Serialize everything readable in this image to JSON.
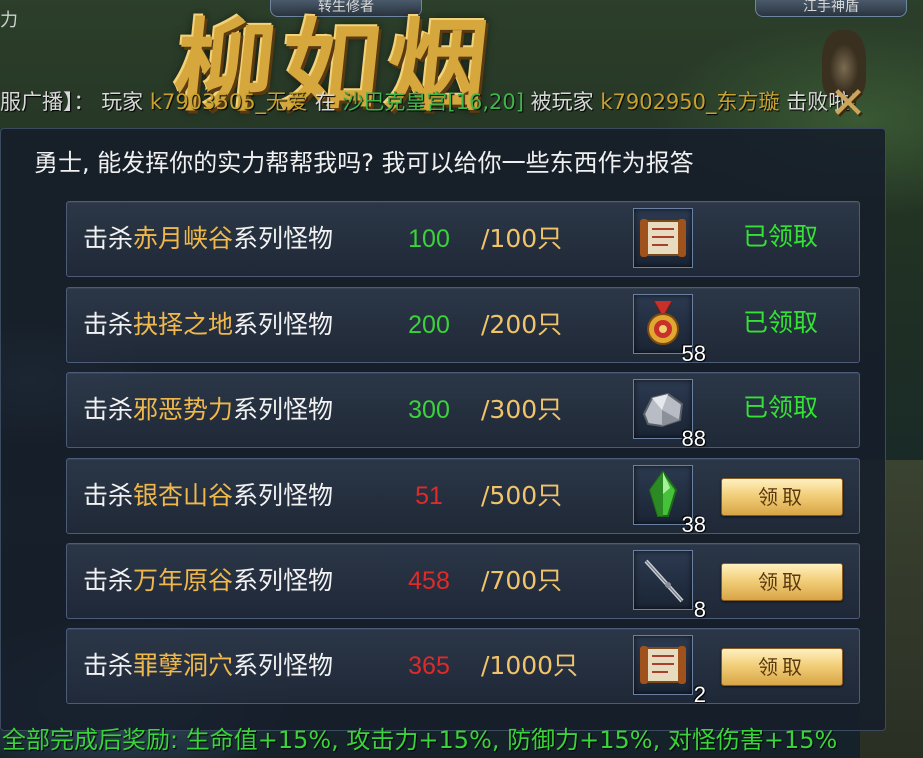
{
  "header": {
    "left_tab": "转生修者",
    "right_tab": "江手神盾",
    "edge_text": "力",
    "title": "柳如烟",
    "close_icon": "close-icon"
  },
  "broadcast": {
    "prefix": "服广播】：",
    "t1": "玩家",
    "player1": "k7903505_无爱",
    "t2": "在",
    "place": "沙巴克皇宫[16,20]",
    "t3": "被玩家",
    "player2": "k7902950_东方璇",
    "t4": "击败啦!"
  },
  "intro": "勇士, 能发挥你的实力帮帮我吗? 我可以给你一些东西作为报答",
  "quests": [
    {
      "prefix": "击杀",
      "area": "赤月峡谷",
      "suffix": "系列怪物",
      "current": "100",
      "target": "/100只",
      "status": "done",
      "reward_icon": "scroll-icon",
      "reward_qty": "",
      "action": "已领取"
    },
    {
      "prefix": "击杀",
      "area": "抉择之地",
      "suffix": "系列怪物",
      "current": "200",
      "target": "/200只",
      "status": "done",
      "reward_icon": "medal-icon",
      "reward_qty": "58",
      "action": "已领取"
    },
    {
      "prefix": "击杀",
      "area": "邪恶势力",
      "suffix": "系列怪物",
      "current": "300",
      "target": "/300只",
      "status": "done",
      "reward_icon": "ore-icon",
      "reward_qty": "88",
      "action": "已领取"
    },
    {
      "prefix": "击杀",
      "area": "银杏山谷",
      "suffix": "系列怪物",
      "current": "51",
      "target": "/500只",
      "status": "todo",
      "reward_icon": "green-crystal-icon",
      "reward_qty": "38",
      "action": "领取"
    },
    {
      "prefix": "击杀",
      "area": "万年原谷",
      "suffix": "系列怪物",
      "current": "458",
      "target": "/700只",
      "status": "todo",
      "reward_icon": "staff-icon",
      "reward_qty": "8",
      "action": "领取"
    },
    {
      "prefix": "击杀",
      "area": "罪孽洞穴",
      "suffix": "系列怪物",
      "current": "365",
      "target": "/1000只",
      "status": "todo",
      "reward_icon": "scroll-icon",
      "reward_qty": "2",
      "action": "领取"
    }
  ],
  "reward_summary": "全部完成后奖励: 生命值+15%, 攻击力+15%, 防御力+15%, 对怪伤害+15%",
  "colors": {
    "done_count": "#3bd23b",
    "todo_count": "#e02a2a",
    "area": "#f0b84a",
    "claimed": "#33e233"
  }
}
